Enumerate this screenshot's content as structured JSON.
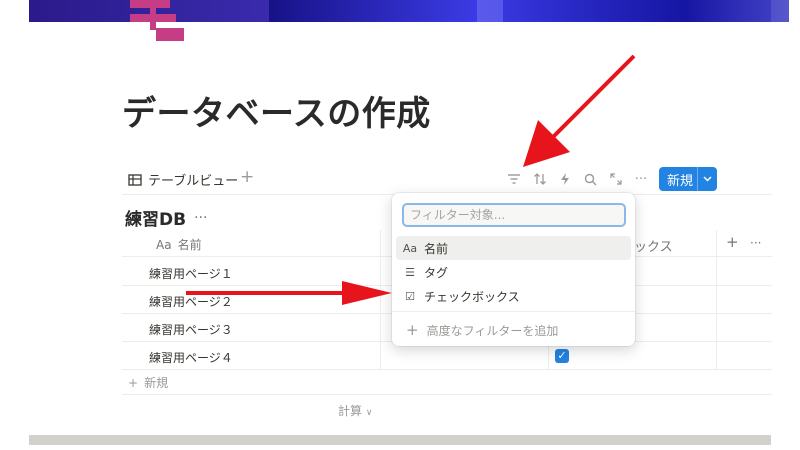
{
  "page": {
    "title": "データベースの作成"
  },
  "toolbar": {
    "view_tab_label": "テーブルビュー",
    "add_view": "+",
    "new_button_label": "新規",
    "new_button_chevron": "⌄",
    "more_glyph": "···"
  },
  "database": {
    "title": "練習DB",
    "more_glyph": "···",
    "columns": {
      "name_icon": "Aa",
      "name": "名前",
      "checkbox_partial": "ックス",
      "add": "+",
      "more": "···"
    },
    "rows": [
      {
        "name": "練習用ページ１",
        "checked": false
      },
      {
        "name": "練習用ページ２",
        "checked": false
      },
      {
        "name": "練習用ページ３",
        "checked": false
      },
      {
        "name": "練習用ページ４",
        "checked": true
      }
    ],
    "new_row_label": "新規",
    "calc_label": "計算"
  },
  "filter_popup": {
    "placeholder": "フィルター対象...",
    "items": [
      {
        "icon": "Aa",
        "label": "名前"
      },
      {
        "icon": "☰",
        "label": "タグ"
      },
      {
        "icon": "☑",
        "label": "チェックボックス"
      }
    ],
    "add_label": "高度なフィルターを追加"
  },
  "colors": {
    "accent": "#2383e2",
    "annotation_arrow": "#e8141c",
    "page_icon": "#c63d86"
  }
}
